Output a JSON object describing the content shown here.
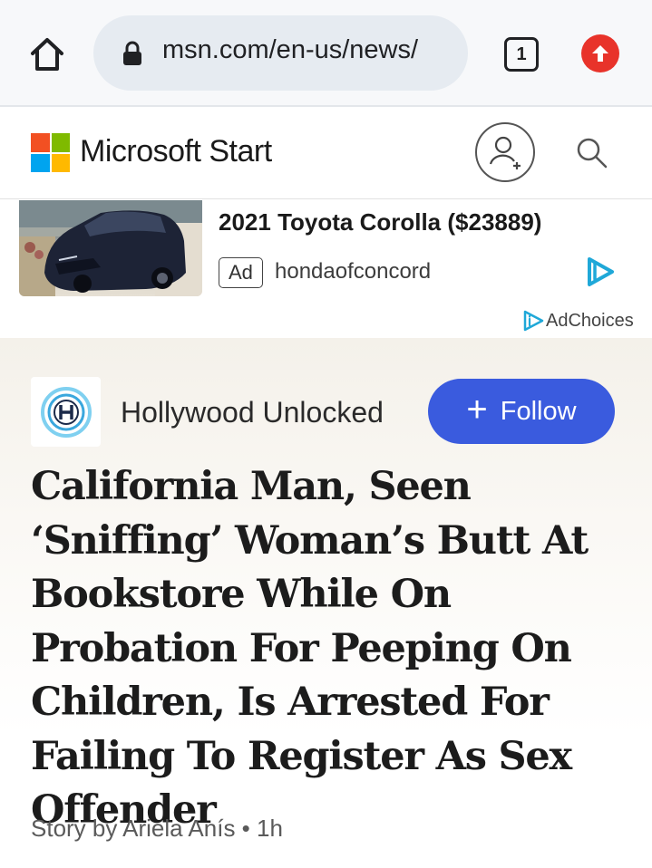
{
  "browser": {
    "url": "msn.com/en-us/news/",
    "tab_count": "1",
    "icons": {
      "home": "home-icon",
      "lock": "lock-icon",
      "update": "update-arrow-icon"
    },
    "accent_color": "#e8332a"
  },
  "header": {
    "brand": "Microsoft Start",
    "logo_colors": [
      "#f25022",
      "#7fba00",
      "#00a4ef",
      "#ffb900"
    ],
    "icons": {
      "account": "add-account-icon",
      "search": "search-icon"
    }
  },
  "ad": {
    "title": "2021 Toyota Corolla ($23889)",
    "badge": "Ad",
    "source": "hondaofconcord",
    "adchoices_label": "AdChoices",
    "icon_color": "#1fa8d8"
  },
  "article": {
    "publisher": "Hollywood Unlocked",
    "follow_label": "Follow",
    "follow_color": "#3a5bde",
    "headline": "California Man, Seen ‘Sniffing’ Woman’s Butt At Bookstore While On Probation For Peeping On Children, Is Arrested For Failing To Register As Sex Offender",
    "byline": "Story by Ariela Anís • 1h"
  }
}
